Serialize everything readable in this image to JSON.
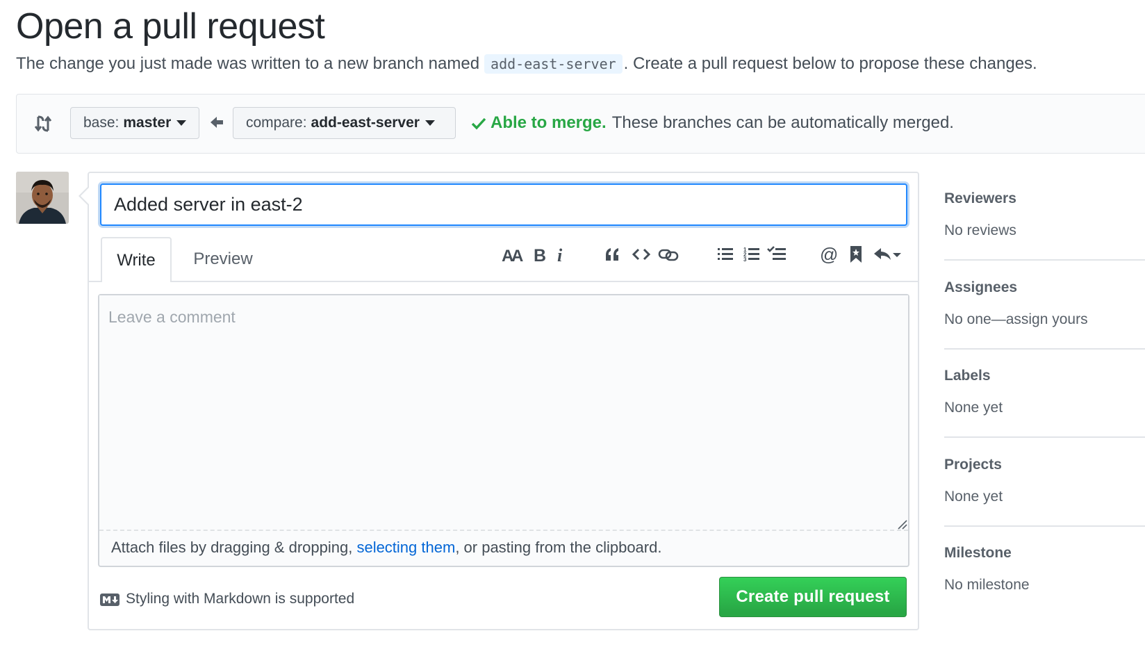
{
  "header": {
    "title": "Open a pull request",
    "intro_prefix": "The change you just made was written to a new branch named",
    "branch_name": "add-east-server",
    "intro_suffix": ". Create a pull request below to propose these changes."
  },
  "compare": {
    "base_label": "base:",
    "base_value": "master",
    "compare_label": "compare:",
    "compare_value": "add-east-server",
    "merge_ok": "Able to merge.",
    "merge_detail": "These branches can be automatically merged.",
    "ok_color": "#28a745"
  },
  "form": {
    "title_value": "Added server in east-2",
    "tabs": [
      {
        "label": "Write",
        "active": true
      },
      {
        "label": "Preview",
        "active": false
      }
    ],
    "toolbar": [
      {
        "icon": "text-size-icon"
      },
      {
        "icon": "bold-icon"
      },
      {
        "icon": "italic-icon"
      },
      {
        "icon": "quote-icon"
      },
      {
        "icon": "code-icon"
      },
      {
        "icon": "link-icon"
      },
      {
        "icon": "unordered-list-icon"
      },
      {
        "icon": "ordered-list-icon"
      },
      {
        "icon": "task-list-icon"
      },
      {
        "icon": "mention-icon"
      },
      {
        "icon": "saved-reply-icon"
      },
      {
        "icon": "reply-icon"
      }
    ],
    "comment_placeholder": "Leave a comment",
    "attach_prefix": "Attach files by dragging & dropping, ",
    "attach_link": "selecting them",
    "attach_suffix": ", or pasting from the clipboard.",
    "markdown_note": "Styling with Markdown is supported",
    "submit_label": "Create pull request",
    "accent_color": "#2188ff",
    "link_color": "#0366d6"
  },
  "sidebar": {
    "sections": [
      {
        "title": "Reviewers",
        "value": "No reviews"
      },
      {
        "title": "Assignees",
        "value": "No one—assign yours"
      },
      {
        "title": "Labels",
        "value": "None yet"
      },
      {
        "title": "Projects",
        "value": "None yet"
      },
      {
        "title": "Milestone",
        "value": "No milestone"
      }
    ]
  }
}
